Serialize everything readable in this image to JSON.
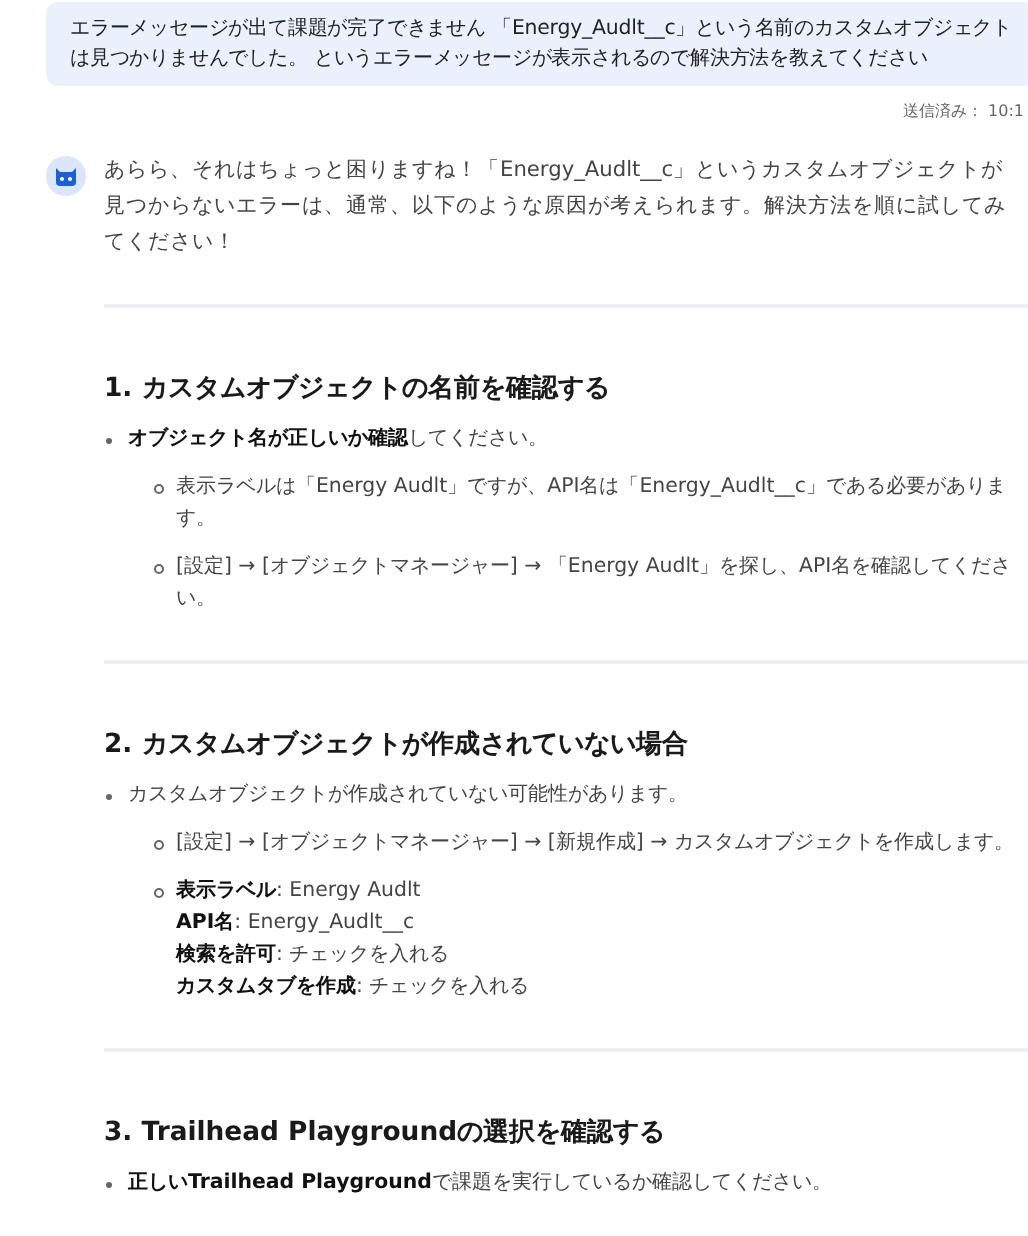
{
  "user_message": {
    "lines": [
      "エラーメッセージが出て課題が完了できません 「Energy_Audlt__c」という名前のカスタムオブジェクト",
      "は見つかりませんでした。 というエラーメッセージが表示されるので解決方法を教えてください"
    ],
    "status": "送信済み： 10:1"
  },
  "assistant_message": {
    "intro": "あらら、それはちょっと困りますね！「Energy_Audlt__c」というカスタムオブジェクトが見つからないエラーは、通常、以下のような原因が考えられます。解決方法を順に試してみてください！",
    "sections": [
      {
        "heading": "1. カスタムオブジェクトの名前を確認する",
        "items": [
          {
            "lines": [
              "**オブジェクト名が正しいか確認**してください。"
            ],
            "children": [
              {
                "lines": [
                  "表示ラベルは「Energy Audlt」ですが、API名は「Energy_Audlt__c」である必要があります。"
                ]
              },
              {
                "lines": [
                  "[設定] → [オブジェクトマネージャー] → 「Energy Audlt」を探し、API名を確認してください。"
                ]
              }
            ]
          }
        ]
      },
      {
        "heading": "2. カスタムオブジェクトが作成されていない場合",
        "items": [
          {
            "lines": [
              "カスタムオブジェクトが作成されていない可能性があります。"
            ],
            "children": [
              {
                "lines": [
                  "[設定] → [オブジェクトマネージャー] → [新規作成] → カスタムオブジェクトを作成します。"
                ]
              },
              {
                "lines": [
                  "**表示ラベル**: Energy Audlt",
                  "**API名**: Energy_Audlt__c",
                  "**検索を許可**: チェックを入れる",
                  "**カスタムタブを作成**: チェックを入れる"
                ]
              }
            ]
          }
        ]
      },
      {
        "heading": "3. Trailhead Playgroundの選択を確認する",
        "items": [
          {
            "lines": [
              "**正しいTrailhead Playground**で課題を実行しているか確認してください。"
            ]
          }
        ]
      }
    ]
  }
}
